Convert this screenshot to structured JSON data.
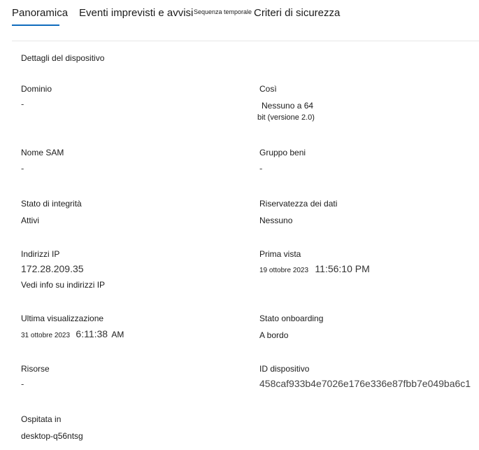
{
  "tabs": [
    {
      "label": "Panoramica",
      "selected": true
    },
    {
      "label": "Eventi imprevisti e avvisi"
    },
    {
      "label": "Sequenza temporale"
    },
    {
      "label": "Criteri di sicurezza"
    }
  ],
  "accent_color": "#0f6cbd",
  "section_title": "Dettagli del dispositivo",
  "fields": {
    "domain": {
      "label": "Dominio",
      "value": "-"
    },
    "os": {
      "label": "Così",
      "value_line1": "Nessuno a 64",
      "value_line2": "bit (versione 2.0)"
    },
    "sam_name": {
      "label": "Nome SAM",
      "value": "-"
    },
    "asset_group": {
      "label": "Gruppo beni",
      "value": "-"
    },
    "health_state": {
      "label": "Stato di integrità",
      "value": "Attivi"
    },
    "data_sensitivity": {
      "label": "Riservatezza dei dati",
      "value": "Nessuno"
    },
    "ip_addresses": {
      "label": "Indirizzi IP",
      "value": "172.28.209.35",
      "link": "Vedi info su indirizzi IP"
    },
    "first_seen": {
      "label": "Prima vista",
      "date": "19 ottobre 2023",
      "time": "11:56:10 PM"
    },
    "last_seen": {
      "label": "Ultima visualizzazione",
      "date": "31 ottobre 2023",
      "time": "6:11:38",
      "ampm": "AM"
    },
    "onboarding_status": {
      "label": "Stato onboarding",
      "value": "A bordo"
    },
    "resources": {
      "label": "Risorse",
      "value": "-"
    },
    "device_id": {
      "label": "ID dispositivo",
      "value": "458caf933b4e7026e176e336e87fbb7e049ba6c1"
    },
    "hosted_in": {
      "label": "Ospitata in",
      "value": "desktop-q56ntsg"
    }
  }
}
